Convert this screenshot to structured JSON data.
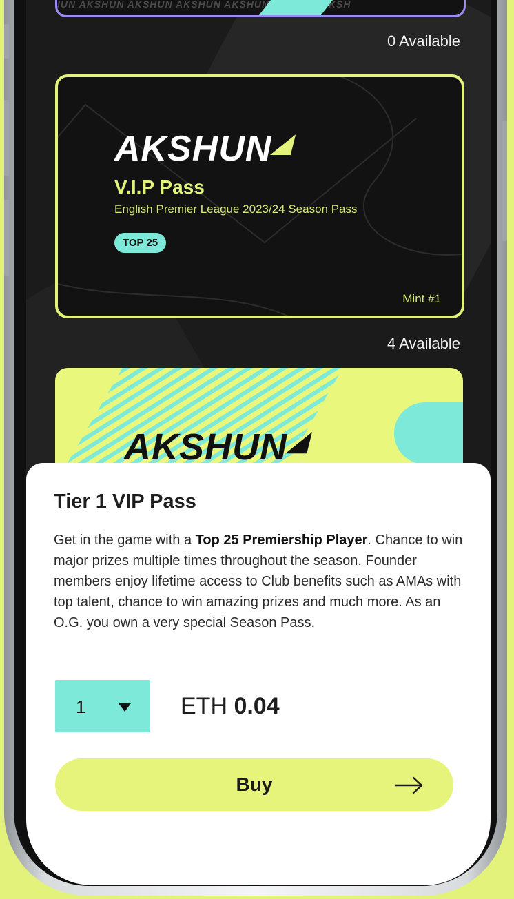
{
  "top_card": {
    "brand_strip": "IUN AKSHUN AKSHUN AKSHUN AKSHUN AKSHUN AKSH",
    "availability": "0 Available"
  },
  "vip_card": {
    "logo_text": "AKSHUN",
    "title": "V.I.P Pass",
    "subtitle": "English Premier League 2023/24 Season Pass",
    "badge": "TOP 25",
    "mint": "Mint #1",
    "availability": "4 Available"
  },
  "next_card": {
    "logo_text": "AKSHUN"
  },
  "sheet": {
    "title": "Tier 1 VIP Pass",
    "desc_prefix": "Get in the game with a ",
    "desc_bold": "Top 25 Premiership Player",
    "desc_rest": ". Chance to win major prizes multiple times throughout the season. Founder members enjoy lifetime access to Club benefits such as AMAs with top talent, chance to win amazing prizes and much more. As an O.G. you own a very special Season Pass.",
    "quantity": "1",
    "currency": "ETH",
    "price": "0.04",
    "buy_label": "Buy"
  },
  "colors": {
    "accent_yellow": "#e2f27a",
    "accent_teal": "#7de9d8",
    "outline_purple": "#9b8cf0"
  },
  "icons": [
    "chevron-down-icon",
    "arrow-right-icon"
  ]
}
